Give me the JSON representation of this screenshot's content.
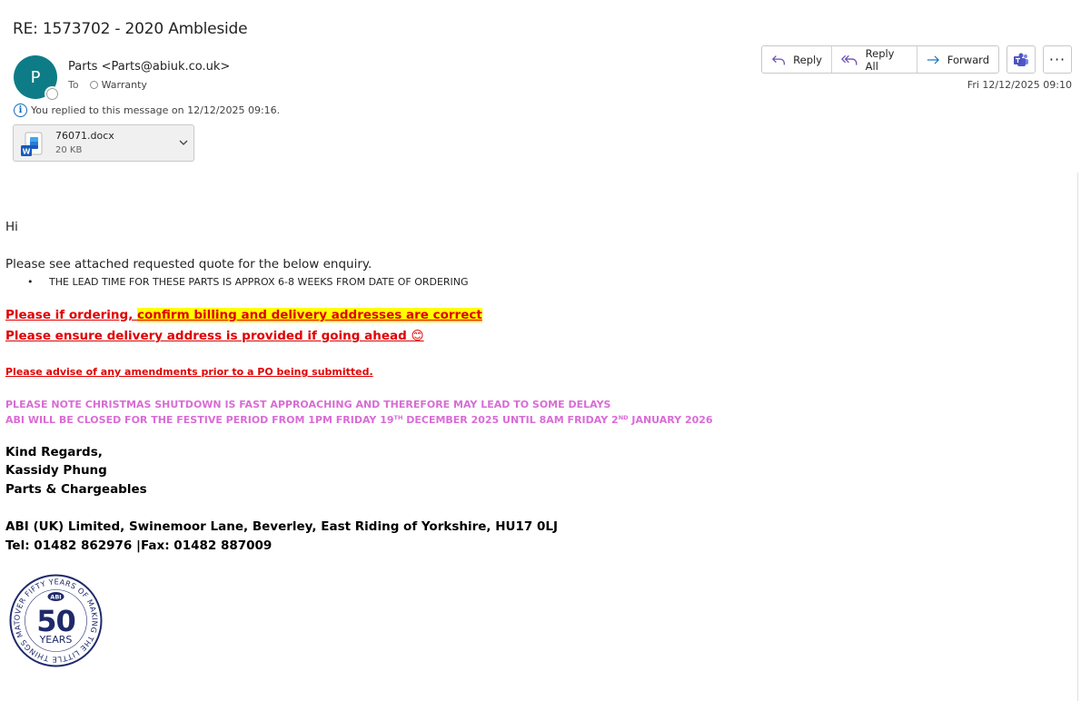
{
  "email": {
    "subject": "RE: 1573702 - 2020 Ambleside",
    "sender_initial": "P",
    "sender": "Parts <Parts@abiuk.co.uk>",
    "to_label": "To",
    "recipient": "Warranty",
    "replied_notice": "You replied to this message on 12/12/2025 09:16.",
    "date": "Fri 12/12/2025 09:10"
  },
  "attachment": {
    "filename": "76071.docx",
    "size": "20 KB"
  },
  "toolbar": {
    "reply_label": "Reply",
    "reply_all_label": "Reply All",
    "forward_label": "Forward"
  },
  "body": {
    "greeting": "Hi",
    "intro": "Please see attached requested quote for the below enquiry.",
    "bullet": "THE LEAD TIME FOR THESE PARTS IS APPROX 6-8 WEEKS FROM DATE OF ORDERING",
    "red_line1_a": "Please if ordering, ",
    "red_line1_b": "confirm billing and delivery addresses are correct",
    "red_line2": "Please ensure delivery address is provided if going ahead 😊",
    "red_line3": "Please advise of any amendments prior to a PO being submitted.",
    "pink_line1": "PLEASE NOTE CHRISTMAS SHUTDOWN IS FAST APPROACHING AND THEREFORE MAY LEAD TO SOME DELAYS",
    "pink_line2_a": "ABI WILL BE CLOSED FOR THE FESTIVE PERIOD FROM 1PM FRIDAY 19",
    "pink_line2_sup1": "TH",
    "pink_line2_b": " DECEMBER 2025 UNTIL 8AM FRIDAY 2",
    "pink_line2_sup2": "ND",
    "pink_line2_c": " JANUARY 2026"
  },
  "signature": {
    "regards": "Kind Regards,",
    "name": "Kassidy Phung",
    "dept": "Parts & Chargeables",
    "address": "ABI (UK) Limited, Swinemoor Lane, Beverley, East Riding of Yorkshire, HU17 0LJ",
    "contact": "Tel: 01482 862976 |Fax: 01482 887009"
  },
  "logo": {
    "ring_text": "OVER FIFTY YEARS OF MAKING THE LITTLE THINGS MATTER",
    "brand": "ABI",
    "number": "50",
    "years": "YEARS"
  },
  "colors": {
    "accent": "#0f6cbd",
    "avatar": "#0e7c86",
    "red": "#e00000",
    "pink": "#d96cd6",
    "logo_navy": "#1f2a6b"
  }
}
